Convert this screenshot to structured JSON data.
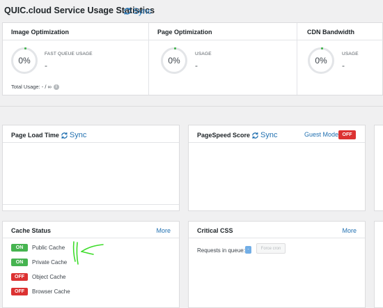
{
  "header": {
    "title": "QUIC.cloud Service Usage Statistics",
    "sync_label": "Sync"
  },
  "usage": [
    {
      "title": "Image Optimization",
      "percent": "0%",
      "label": "FAST QUEUE USAGE",
      "value": "-"
    },
    {
      "title": "Page Optimization",
      "percent": "0%",
      "label": "USAGE",
      "value": "-"
    },
    {
      "title": "CDN Bandwidth",
      "percent": "0%",
      "label": "USAGE",
      "value": "-"
    }
  ],
  "total_usage": "Total Usage: - / ∞",
  "page_load": {
    "title": "Page Load Time",
    "sync_label": "Sync"
  },
  "pagespeed": {
    "title": "PageSpeed Score",
    "sync_label": "Sync",
    "guest_mode_label": "Guest Mode",
    "guest_mode_state": "OFF"
  },
  "cache_status": {
    "title": "Cache Status",
    "more_label": "More",
    "items": [
      {
        "state": "ON",
        "label": "Public Cache"
      },
      {
        "state": "ON",
        "label": "Private Cache"
      },
      {
        "state": "OFF",
        "label": "Object Cache"
      },
      {
        "state": "OFF",
        "label": "Browser Cache"
      }
    ]
  },
  "critical_css": {
    "title": "Critical CSS",
    "more_label": "More",
    "queue_label": "Requests in queue:",
    "queue_value": "-",
    "force_button": "Force cron"
  },
  "colors": {
    "accent": "#2271b1",
    "on": "#46b450",
    "off": "#dc3232",
    "annotation": "#3ddc2a"
  }
}
